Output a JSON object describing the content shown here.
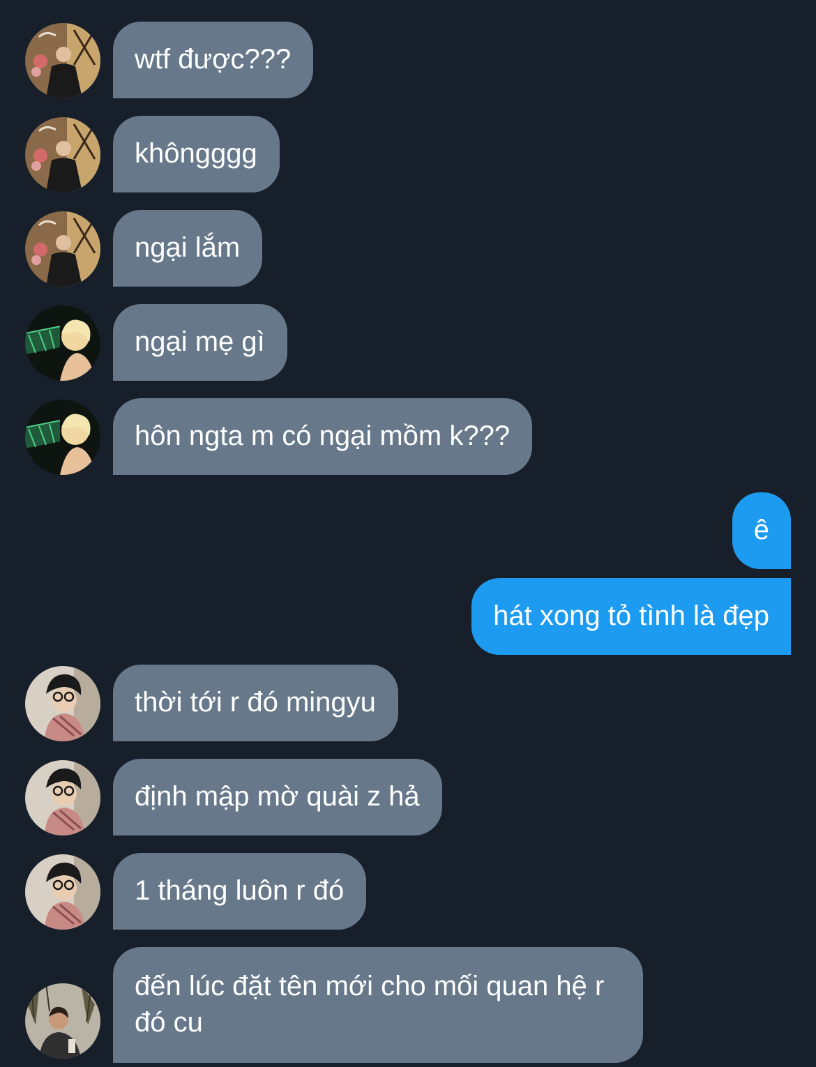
{
  "conversation": {
    "messages": [
      {
        "sender": "user-a",
        "avatar": "avatar-guitar-man",
        "text": "wtf được???"
      },
      {
        "sender": "user-a",
        "avatar": "avatar-guitar-man",
        "text": "khôngggg"
      },
      {
        "sender": "user-a",
        "avatar": "avatar-guitar-man",
        "text": "ngại lắm"
      },
      {
        "sender": "user-b",
        "avatar": "avatar-blonde-person",
        "text": "ngại mẹ gì"
      },
      {
        "sender": "user-b",
        "avatar": "avatar-blonde-person",
        "text": "hôn ngta m có ngại mồm k???"
      },
      {
        "sender": "me",
        "text": "ê"
      },
      {
        "sender": "me",
        "text": "hát xong tỏ tình là đẹp"
      },
      {
        "sender": "user-c",
        "avatar": "avatar-glasses-person",
        "text": "thời tới r đó mingyu"
      },
      {
        "sender": "user-c",
        "avatar": "avatar-glasses-person",
        "text": "định mập mờ quài z hả"
      },
      {
        "sender": "user-c",
        "avatar": "avatar-glasses-person",
        "text": "1 tháng luôn r đó"
      },
      {
        "sender": "user-d",
        "avatar": "avatar-outdoor-man",
        "text": "đến lúc đặt tên mới cho mối quan hệ r đó cu"
      }
    ]
  },
  "colors": {
    "background": "#17202a",
    "incoming_bubble": "#66788a",
    "outgoing_bubble": "#1d9bf0",
    "text": "#ffffff"
  }
}
